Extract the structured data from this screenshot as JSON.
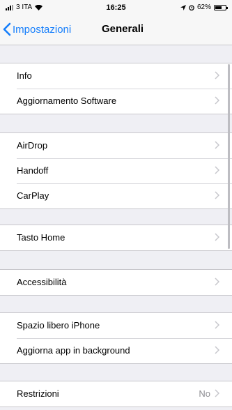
{
  "status": {
    "carrier": "3 ITA",
    "time": "16:25",
    "battery": "62%",
    "battery_level": 0.62
  },
  "nav": {
    "back_label": "Impostazioni",
    "title": "Generali"
  },
  "groups": [
    {
      "rows": [
        {
          "label": "Info"
        },
        {
          "label": "Aggiornamento Software"
        }
      ]
    },
    {
      "rows": [
        {
          "label": "AirDrop"
        },
        {
          "label": "Handoff"
        },
        {
          "label": "CarPlay"
        }
      ]
    },
    {
      "rows": [
        {
          "label": "Tasto Home"
        }
      ]
    },
    {
      "rows": [
        {
          "label": "Accessibilità"
        }
      ]
    },
    {
      "rows": [
        {
          "label": "Spazio libero iPhone"
        },
        {
          "label": "Aggiorna app in background"
        }
      ]
    },
    {
      "rows": [
        {
          "label": "Restrizioni",
          "value": "No"
        }
      ]
    }
  ]
}
